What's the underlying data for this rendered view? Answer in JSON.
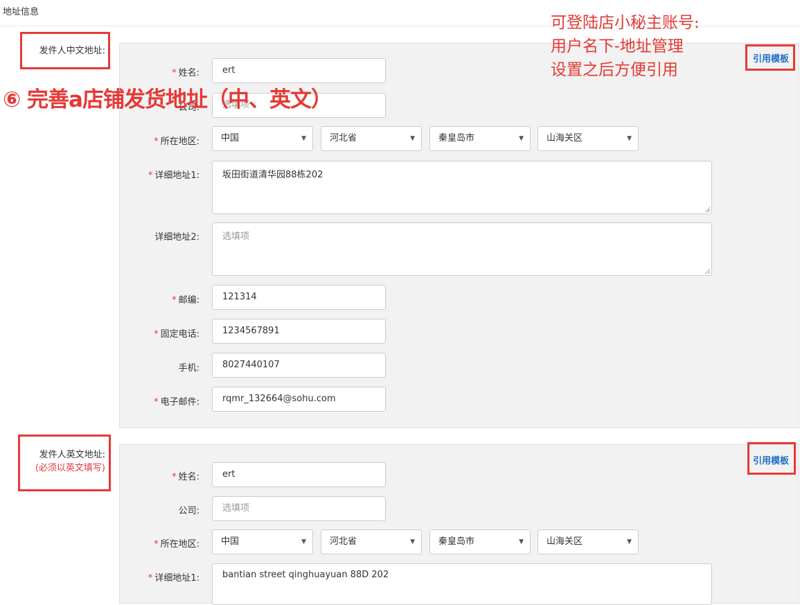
{
  "section_title": "地址信息",
  "annotations": {
    "note": "可登陆店小秘主账号:\n用户名下-地址管理\n设置之后方便引用",
    "step": "⑥ 完善a店铺发货地址（中、英文）"
  },
  "cn_form": {
    "side_label": "发件人中文地址:",
    "template_link": "引用模板",
    "name_label": "姓名:",
    "name_value": "ert",
    "company_label": "公司:",
    "company_placeholder": "选填项",
    "region_label": "所在地区:",
    "country": "中国",
    "province": "河北省",
    "city": "秦皇岛市",
    "district": "山海关区",
    "addr1_label": "详细地址1:",
    "addr1_value": "坂田街道清华园88栋202",
    "addr2_label": "详细地址2:",
    "addr2_placeholder": "选填项",
    "zip_label": "邮编:",
    "zip_value": "121314",
    "phone_label": "固定电话:",
    "phone_value": "1234567891",
    "mobile_label": "手机:",
    "mobile_value": "8027440107",
    "email_label": "电子邮件:",
    "email_value": "rqmr_132664@sohu.com"
  },
  "en_form": {
    "side_label": "发件人英文地址:",
    "side_sublabel": "(必须以英文填写)",
    "template_link": "引用模板",
    "name_label": "姓名:",
    "name_value": "ert",
    "company_label": "公司:",
    "company_placeholder": "选填项",
    "region_label": "所在地区:",
    "country": "中国",
    "province": "河北省",
    "city": "秦皇岛市",
    "district": "山海关区",
    "addr1_label": "详细地址1:",
    "addr1_value": "bantian street qinghuayuan 88D 202"
  },
  "icons": {
    "dropdown": "caret-down-icon",
    "resize": "resize-grip-icon"
  },
  "colors": {
    "accent_red": "#e53935",
    "link_blue": "#1e6fc7",
    "panel_bg": "#f2f2f2"
  }
}
